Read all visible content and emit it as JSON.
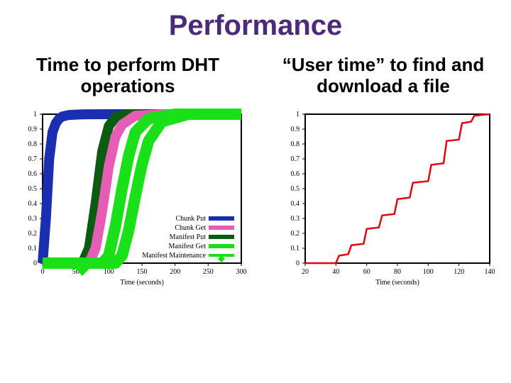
{
  "title": "Performance",
  "subtitle_left": "Time to perform DHT operations",
  "subtitle_right": "“User time” to find and download a file",
  "chart_data": [
    {
      "type": "line",
      "title": "",
      "xlabel": "Time (seconds)",
      "ylabel": "",
      "xlim": [
        0,
        300
      ],
      "ylim": [
        0,
        1
      ],
      "xticks": [
        0,
        50,
        100,
        150,
        200,
        250,
        300
      ],
      "yticks": [
        0,
        0.1,
        0.2,
        0.3,
        0.4,
        0.5,
        0.6,
        0.7,
        0.8,
        0.9,
        1
      ],
      "legend_position": "lower-right",
      "series": [
        {
          "name": "Chunk Put",
          "color": "#1a2fb0",
          "x": [
            0,
            5,
            10,
            15,
            20,
            25,
            30,
            40,
            60,
            100,
            300
          ],
          "y": [
            0,
            0.3,
            0.7,
            0.88,
            0.94,
            0.97,
            0.985,
            0.995,
            0.999,
            1.0,
            1.0
          ]
        },
        {
          "name": "Chunk Get",
          "color": "#e65db6",
          "x": [
            0,
            70,
            80,
            90,
            100,
            110,
            120,
            140,
            180,
            300
          ],
          "y": [
            0,
            0.0,
            0.1,
            0.35,
            0.65,
            0.85,
            0.93,
            0.99,
            1.0,
            1.0
          ]
        },
        {
          "name": "Manifest Put",
          "color": "#0b5c12",
          "x": [
            0,
            60,
            70,
            80,
            90,
            100,
            110,
            130,
            300
          ],
          "y": [
            0,
            0.0,
            0.1,
            0.4,
            0.75,
            0.92,
            0.98,
            1.0,
            1.0
          ]
        },
        {
          "name": "Manifest Get",
          "color": "#19e019",
          "x": [
            0,
            90,
            100,
            110,
            120,
            130,
            140,
            160,
            200,
            300
          ],
          "y": [
            0,
            0.0,
            0.05,
            0.25,
            0.5,
            0.72,
            0.88,
            0.97,
            1.0,
            1.0
          ]
        },
        {
          "name": "Manifest Maintenance",
          "color": "#19e019",
          "x": [
            0,
            110,
            120,
            130,
            140,
            150,
            160,
            180,
            220,
            300
          ],
          "y": [
            0,
            0.0,
            0.05,
            0.22,
            0.45,
            0.66,
            0.82,
            0.95,
            1.0,
            1.0
          ]
        }
      ]
    },
    {
      "type": "line",
      "title": "",
      "xlabel": "Time (seconds)",
      "ylabel": "",
      "xlim": [
        20,
        140
      ],
      "ylim": [
        0,
        1
      ],
      "xticks": [
        20,
        40,
        60,
        80,
        100,
        120,
        140
      ],
      "yticks": [
        0,
        0.1,
        0.2,
        0.3,
        0.4,
        0.5,
        0.6,
        0.7,
        0.8,
        0.9,
        1
      ],
      "series": [
        {
          "name": "",
          "color": "#e30613",
          "x": [
            20,
            40,
            42,
            48,
            50,
            58,
            60,
            68,
            70,
            78,
            80,
            88,
            90,
            100,
            102,
            110,
            112,
            120,
            122,
            128,
            130,
            140
          ],
          "y": [
            0.0,
            0.0,
            0.05,
            0.06,
            0.12,
            0.13,
            0.23,
            0.24,
            0.32,
            0.33,
            0.43,
            0.44,
            0.54,
            0.55,
            0.66,
            0.67,
            0.82,
            0.83,
            0.94,
            0.95,
            0.99,
            1.0
          ]
        }
      ]
    }
  ]
}
